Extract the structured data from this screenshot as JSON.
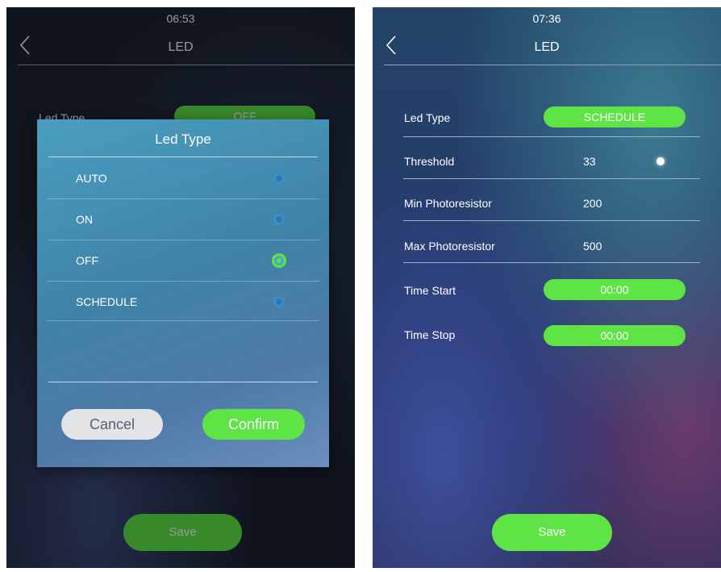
{
  "left_screen": {
    "status_time": "06:53",
    "title": "LED",
    "background_row": {
      "label": "Led Type",
      "value": "OFF"
    },
    "save_label": "Save",
    "dialog": {
      "title": "Led Type",
      "options": [
        {
          "label": "AUTO",
          "selected": false
        },
        {
          "label": "ON",
          "selected": false
        },
        {
          "label": "OFF",
          "selected": true
        },
        {
          "label": "SCHEDULE",
          "selected": false
        }
      ],
      "cancel_label": "Cancel",
      "confirm_label": "Confirm"
    }
  },
  "right_screen": {
    "status_time": "07:36",
    "title": "LED",
    "led_type": {
      "label": "Led Type",
      "value": "SCHEDULE"
    },
    "threshold": {
      "label": "Threshold",
      "value": "33"
    },
    "min_photoresistor": {
      "label": "Min Photoresistor",
      "value": "200"
    },
    "max_photoresistor": {
      "label": "Max Photoresistor",
      "value": "500"
    },
    "time_start": {
      "label": "Time Start",
      "value": "00:00"
    },
    "time_stop": {
      "label": "Time Stop",
      "value": "00:00"
    },
    "save_label": "Save"
  },
  "icons": {
    "back": "chevron-left-icon",
    "radio": "radio-button-icon"
  },
  "colors": {
    "accent": "#5ee545",
    "text": "#ffffff",
    "cancel_bg": "#e2e4e6"
  }
}
